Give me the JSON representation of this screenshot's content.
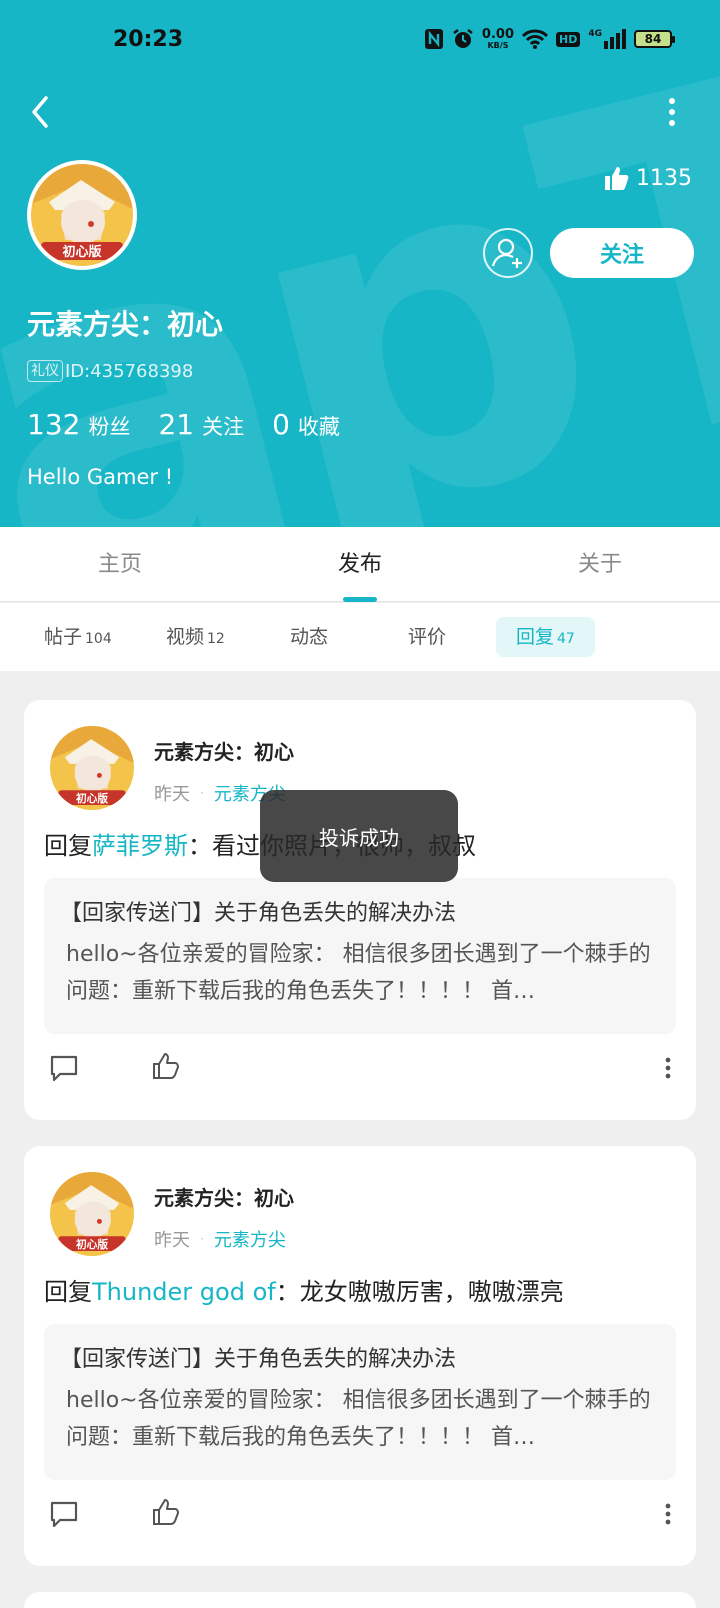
{
  "status_bar": {
    "time": "20:23",
    "net_speed_top": "0.00",
    "net_speed_unit": "KB/S",
    "hd": "HD",
    "signal_label": "4G",
    "battery": "84"
  },
  "header": {
    "bg_color": "#17b6c6",
    "likes": "1135",
    "follow_label": "关注",
    "username": "元素方尖：初心",
    "tag": "礼仪",
    "id_text": "ID:435768398",
    "stats": [
      {
        "num": "132",
        "label": "粉丝"
      },
      {
        "num": "21",
        "label": "关注"
      },
      {
        "num": "0",
        "label": "收藏"
      }
    ],
    "bio": "Hello Gamer !"
  },
  "main_tabs": [
    {
      "label": "主页"
    },
    {
      "label": "发布"
    },
    {
      "label": "关于"
    }
  ],
  "sub_tabs": [
    {
      "label": "帖子",
      "count": "104"
    },
    {
      "label": "视频",
      "count": "12"
    },
    {
      "label": "动态",
      "count": ""
    },
    {
      "label": "评价",
      "count": ""
    },
    {
      "label": "回复",
      "count": "47"
    }
  ],
  "cards": [
    {
      "name": "元素方尖：初心",
      "time": "昨天",
      "dot": "·",
      "game": "元素方尖",
      "reply_prefix": "回复",
      "reply_target": "萨菲罗斯",
      "reply_text": "：看过你照片，很帅，叔叔",
      "quote_title": "【回家传送门】关于角色丢失的解决办法",
      "quote_body": "hello~各位亲爱的冒险家： 相信很多团长遇到了一个棘手的问题：重新下载后我的角色丢失了！！！！ 首…"
    },
    {
      "name": "元素方尖：初心",
      "time": "昨天",
      "dot": "·",
      "game": "元素方尖",
      "reply_prefix": "回复",
      "reply_target": "Thunder god of",
      "reply_text": "：龙女嗷嗷厉害，嗷嗷漂亮",
      "quote_title": "【回家传送门】关于角色丢失的解决办法",
      "quote_body": "hello~各位亲爱的冒险家： 相信很多团长遇到了一个棘手的问题：重新下载后我的角色丢失了！！！！ 首…"
    }
  ],
  "toast": "投诉成功"
}
